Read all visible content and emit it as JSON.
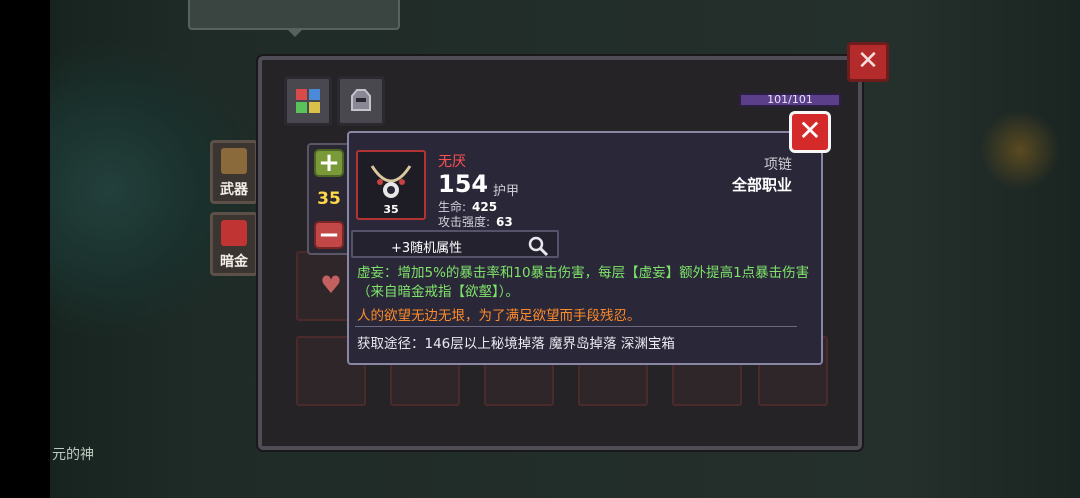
{
  "background": {
    "side_buttons": [
      {
        "label": "武器",
        "icon": "sword-icon"
      },
      {
        "label": "暗金",
        "icon": "dark-gold-icon"
      }
    ],
    "bottom_left_text": "元的神"
  },
  "panel": {
    "close_label": "✕",
    "tabs": [
      {
        "name": "gem-tab",
        "icon": "gem-grid-icon"
      },
      {
        "name": "armor-tab",
        "icon": "helmet-icon"
      }
    ],
    "capacity": "101/101"
  },
  "stepper": {
    "plus_label": "+",
    "minus_label": "−",
    "value": "35"
  },
  "tooltip": {
    "close_label": "✕",
    "item": {
      "name": "无厌",
      "value": "154",
      "value_label": "护甲",
      "level": "35",
      "type": "项链",
      "class": "全部职业",
      "stats": [
        {
          "label": "生命:",
          "value": "425"
        },
        {
          "label": "攻击强度:",
          "value": "63"
        }
      ]
    },
    "random_attr_label": "+3随机属性",
    "effect": "虚妄：增加5%的暴击率和10暴击伤害，每层【虚妄】额外提高1点暴击伤害（来自暗金戒指【欲壑】）。",
    "flavor": "人的欲望无边无垠，为了满足欲望而手段残忍。",
    "source": "获取途径：146层以上秘境掉落 魔界岛掉落 深渊宝箱"
  },
  "colors": {
    "item_name": "#ff5050",
    "effect": "#7fe36a",
    "flavor": "#ff8a2a",
    "level": "#ffd84a"
  }
}
